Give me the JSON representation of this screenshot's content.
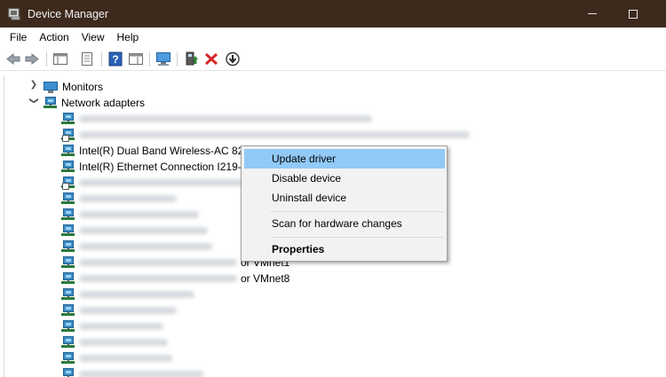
{
  "window": {
    "title": "Device Manager"
  },
  "menubar": {
    "items": [
      "File",
      "Action",
      "View",
      "Help"
    ]
  },
  "toolbar": {
    "buttons": [
      "back-arrow-icon",
      "forward-arrow-icon",
      "show-hide-tree-icon",
      "properties-sheet-icon",
      "help-icon",
      "action-pane-icon",
      "scan-monitor-icon",
      "update-driver-icon",
      "uninstall-x-icon",
      "disable-download-icon"
    ],
    "colors": {
      "help": "#2a62b8",
      "uninstall": "#d8262c",
      "update": "#2f8c3a"
    }
  },
  "tree": {
    "monitors_label": "Monitors",
    "network_adapters_label": "Network adapters",
    "intel_wireless_label": "Intel(R) Dual Band Wireless-AC 826",
    "intel_ethernet_label": "Intel(R) Ethernet Connection I219-V",
    "vmnet1_suffix": "or VMnet1",
    "vmnet8_suffix": "or VMnet8"
  },
  "context_menu": {
    "update_driver": "Update driver",
    "disable_device": "Disable device",
    "uninstall_device": "Uninstall device",
    "scan_hardware": "Scan for hardware changes",
    "properties": "Properties",
    "highlight_color": "#91c9f7"
  },
  "colors": {
    "titlebar": "#3d2a1d"
  }
}
